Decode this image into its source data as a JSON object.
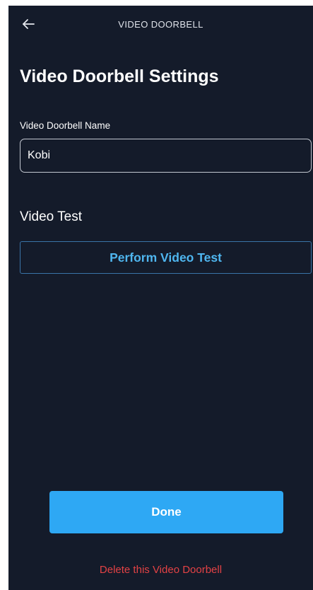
{
  "header": {
    "back_icon": "left-arrow-icon",
    "title": "VIDEO DOORBELL"
  },
  "page": {
    "title": "Video Doorbell Settings"
  },
  "name_field": {
    "label": "Video Doorbell Name",
    "value": "Kobi"
  },
  "video_test": {
    "section_label": "Video Test",
    "button_label": "Perform Video Test"
  },
  "actions": {
    "done_label": "Done",
    "delete_label": "Delete this Video Doorbell"
  },
  "colors": {
    "background": "#141b2a",
    "accent": "#2ea8f4",
    "link_blue": "#4fb6ef",
    "danger": "#e34245"
  }
}
